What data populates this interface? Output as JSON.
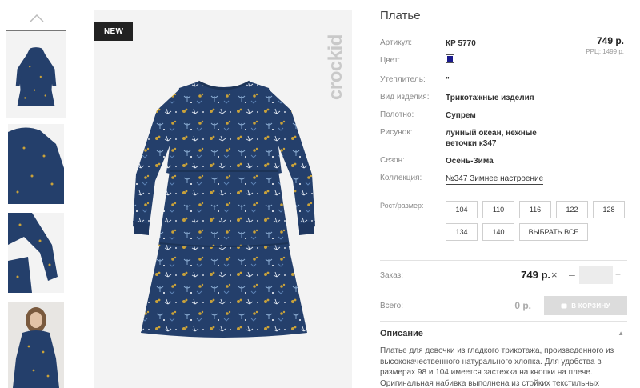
{
  "gallery": {
    "badge": "NEW",
    "brand": "crockid"
  },
  "product": {
    "title": "Платье",
    "price": "749 р.",
    "rrp": "РРЦ: 1499 р.",
    "color_hex": "#1a1a8c",
    "attributes": [
      {
        "label": "Артикул:",
        "value": "КР 5770"
      },
      {
        "label": "Цвет:",
        "value": ""
      },
      {
        "label": "Утеплитель:",
        "value": "\""
      },
      {
        "label": "Вид изделия:",
        "value": "Трикотажные изделия"
      },
      {
        "label": "Полотно:",
        "value": "Супрем"
      },
      {
        "label": "Рисунок:",
        "value_line1": "лунный океан, нежные",
        "value_line2": "веточки к347"
      },
      {
        "label": "Сезон:",
        "value": "Осень-Зима"
      },
      {
        "label": "Коллекция:",
        "value": "№347 Зимнее настроение"
      }
    ]
  },
  "sizes": {
    "label": "Рост/размер:",
    "options": [
      "104",
      "110",
      "116",
      "122",
      "128",
      "134",
      "140"
    ],
    "select_all": "ВЫБРАТЬ ВСЕ"
  },
  "order": {
    "label": "Заказ:",
    "price": "749 р.",
    "times": "×",
    "minus": "–",
    "plus": "+",
    "quantity": ""
  },
  "total": {
    "label": "Всего:",
    "value": "0 р.",
    "cart_button": "В КОРЗИНУ"
  },
  "description": {
    "title": "Описание",
    "toggle": "▲",
    "lines": [
      "Платье для девочки из гладкого трикотажа, произведенного из",
      "высококачественного натурального хлопка. Для удобства в",
      "размерах 98 и 104 имеется застежка на кнопки на плече.",
      "Оригинальная набивка выполнена из стойких текстильных"
    ]
  },
  "colors": {
    "dress": "#243f6b",
    "accent_gold": "#c9a23a"
  }
}
